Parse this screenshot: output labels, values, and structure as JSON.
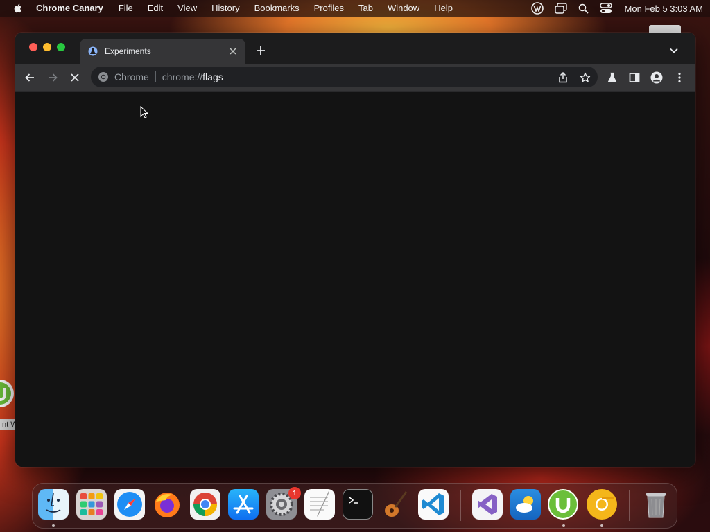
{
  "menubar": {
    "apple_icon": "apple-logo-icon",
    "app_name": "Chrome Canary",
    "items": [
      "File",
      "Edit",
      "View",
      "History",
      "Bookmarks",
      "Profiles",
      "Tab",
      "Window",
      "Help"
    ],
    "status_icons": [
      "wordpress-icon",
      "screen-mirroring-icon",
      "spotlight-search-icon",
      "control-center-icon"
    ],
    "clock": "Mon Feb 5  3:03 AM"
  },
  "desktop": {
    "partial_label": "nt W"
  },
  "browser": {
    "tab": {
      "title": "Experiments",
      "favicon": "experiments-flask-icon"
    },
    "omnibox": {
      "chip": "Chrome",
      "url_scheme": "chrome://",
      "url_host": "flags"
    },
    "toolbar_icons": [
      "back-arrow-icon",
      "forward-arrow-icon",
      "stop-loading-icon",
      "share-icon",
      "bookmark-star-icon",
      "labs-flask-icon",
      "side-panel-icon",
      "profile-icon",
      "more-menu-icon"
    ]
  },
  "dock": {
    "apps": [
      {
        "name": "Finder",
        "running": true
      },
      {
        "name": "Launchpad",
        "running": false
      },
      {
        "name": "Safari",
        "running": false
      },
      {
        "name": "Firefox",
        "running": false
      },
      {
        "name": "Google Chrome",
        "running": false
      },
      {
        "name": "App Store",
        "running": false
      },
      {
        "name": "System Settings",
        "running": false,
        "badge": "1"
      },
      {
        "name": "TextEdit",
        "running": false
      },
      {
        "name": "Terminal",
        "running": false
      },
      {
        "name": "GarageBand",
        "running": false
      },
      {
        "name": "Visual Studio Code",
        "running": false
      },
      {
        "name": "Visual Studio",
        "running": false
      },
      {
        "name": "Weather",
        "running": false
      },
      {
        "name": "uTorrent Web",
        "running": true
      },
      {
        "name": "Chrome Canary",
        "running": true
      },
      {
        "name": "Trash",
        "running": false
      }
    ]
  },
  "colors": {
    "window_bg": "#131313",
    "toolbar_bg": "#353537",
    "omnibox_bg": "#202124",
    "badge_red": "#e8372e",
    "canary_yellow": "#f4b61a"
  }
}
